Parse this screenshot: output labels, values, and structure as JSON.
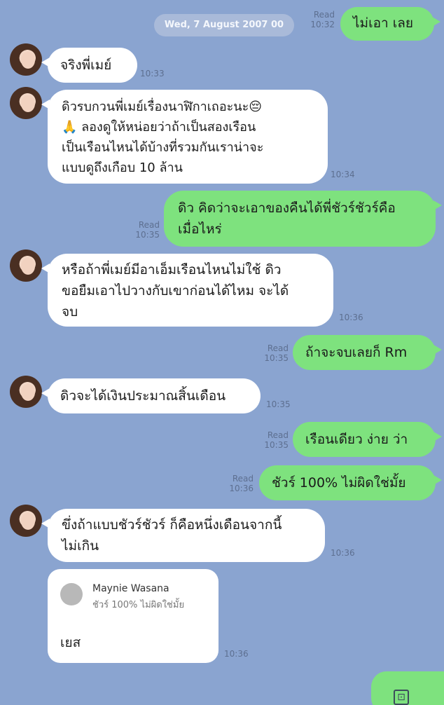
{
  "date_pill": "Wed, 7 August 2007 00",
  "messages": [
    {
      "lines": [
        "ไม่เอา เลย"
      ],
      "status": "Read",
      "time": "10:32"
    },
    {
      "lines": [
        "จริงพี่เมย์"
      ],
      "time": "10:33"
    },
    {
      "lines": [
        "ดิวรบกวนพี่เมย์เรื่องนาฬิกาเถอะนะ😔",
        "🙏 ลองดูให้หน่อยว่าถ้าเป็นสองเรือน",
        "เป็นเรือนไหนได้บ้างที่รวมกันเราน่าจะ",
        "แบบดูถึงเกือบ 10 ล้าน"
      ],
      "time": "10:34"
    },
    {
      "lines": [
        "ดิว คิดว่าจะเอาของคืนได้พี่ชัวร์ชัวร์คือ",
        "เมื่อไหร่"
      ],
      "status": "Read",
      "time": "10:35"
    },
    {
      "lines": [
        "หรือถ้าพี่เมย์มีอาเอ็มเรือนไหนไม่ใช้ ดิว",
        "ขอยืมเอาไปวางกับเขาก่อนได้ไหม จะได้",
        "จบ"
      ],
      "time": "10:36"
    },
    {
      "lines": [
        "ถ้าจะจบเลยก็ Rm"
      ],
      "status": "Read",
      "time": "10:35"
    },
    {
      "lines": [
        "ดิวจะได้เงินประมาณสิ้นเดือน"
      ],
      "time": "10:35"
    },
    {
      "lines": [
        "เรือนเดียว ง่าย ว่า"
      ],
      "status": "Read",
      "time": "10:35"
    },
    {
      "lines": [
        "ชัวร์ 100% ไม่ผิดใช่มั้ย"
      ],
      "status": "Read",
      "time": "10:36"
    },
    {
      "lines": [
        "ขึ่งถ้าแบบชัวร์ชัวร์ ก็คือหนึ่งเดือนจากนี้",
        "ไม่เกิน"
      ],
      "time": "10:36"
    }
  ],
  "reply": {
    "name": "Maynie Wasana",
    "quote": "ชัวร์ 100% ไม่ผิดใช่มั้ย",
    "text": "เยส",
    "time": "10:36"
  },
  "partial_icon": "image-icon",
  "colors": {
    "background": "#8aa4d0",
    "incoming": "#ffffff",
    "outgoing": "#7ee27e"
  }
}
